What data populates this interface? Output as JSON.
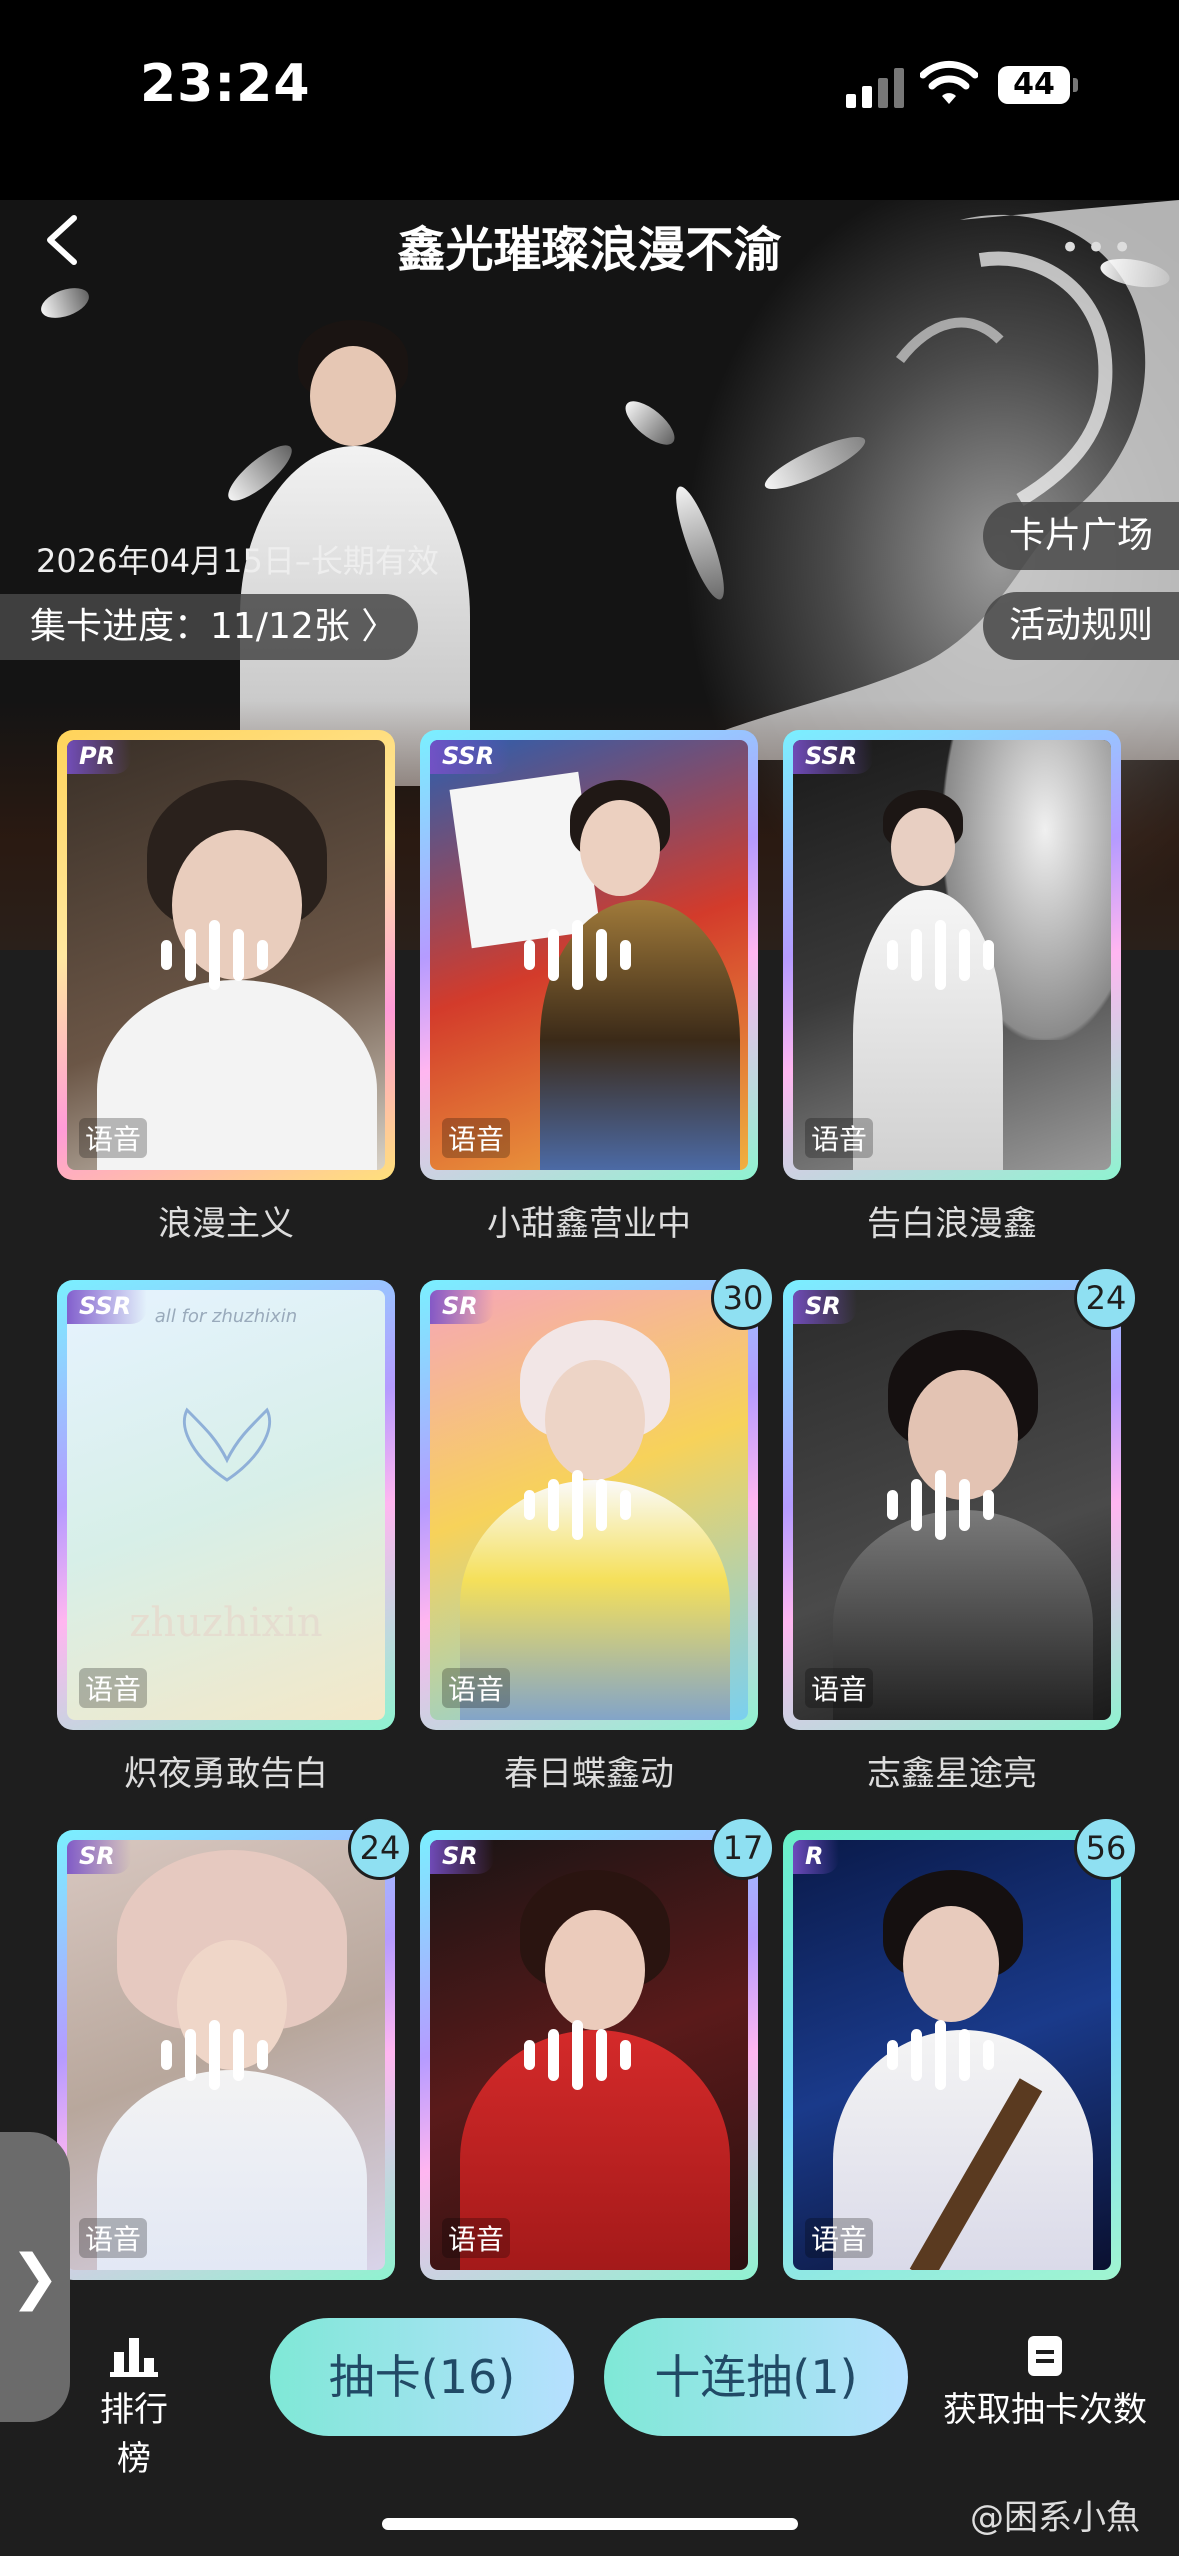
{
  "status_bar": {
    "time": "23:24",
    "battery": "44"
  },
  "header": {
    "title": "鑫光璀璨浪漫不渝",
    "date_range": "2026年04月15日–长期有效",
    "progress": "集卡进度：11/12张 〉",
    "card_plaza": "卡片广场",
    "rules": "活动规则"
  },
  "cards": [
    {
      "rarity": "PR",
      "name": "浪漫主义",
      "voice": "语音",
      "count": ""
    },
    {
      "rarity": "SSR",
      "name": "小甜鑫营业中",
      "voice": "语音",
      "count": ""
    },
    {
      "rarity": "SSR",
      "name": "告白浪漫鑫",
      "voice": "语音",
      "count": ""
    },
    {
      "rarity": "SSR",
      "name": "炽夜勇敢告白",
      "voice": "语音",
      "count": "",
      "art_text": "zhuzhixin",
      "art_caption": "all for zhuzhixin"
    },
    {
      "rarity": "SR",
      "name": "春日蝶鑫动",
      "voice": "语音",
      "count": "30"
    },
    {
      "rarity": "SR",
      "name": "志鑫星途亮",
      "voice": "语音",
      "count": "24"
    },
    {
      "rarity": "SR",
      "name": "",
      "voice": "语音",
      "count": "24"
    },
    {
      "rarity": "SR",
      "name": "",
      "voice": "语音",
      "count": "17"
    },
    {
      "rarity": "R",
      "name": "",
      "voice": "语音",
      "count": "56"
    }
  ],
  "bottom": {
    "ranking": "排行榜",
    "draw": "抽卡(16)",
    "draw_ten": "十连抽(1)",
    "get_times": "获取抽卡次数"
  },
  "side_tab_icon": "chevron-right-icon",
  "watermark": "@困系小魚",
  "colors": {
    "background": "#1e1e1e",
    "button_gradient_start": "#7fe8d6",
    "button_gradient_end": "#b6e0ff",
    "badge": "#8fe0f2"
  }
}
